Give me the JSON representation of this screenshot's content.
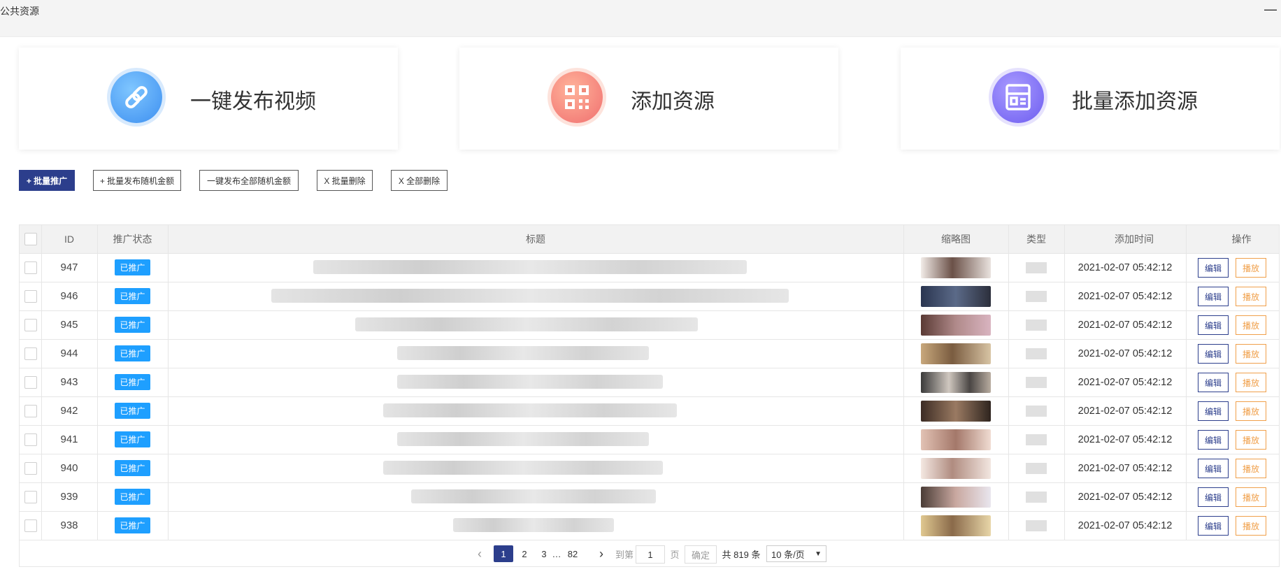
{
  "window": {
    "title": "公共资源",
    "minimize_label": "—"
  },
  "cards": [
    {
      "label": "一键发布视频",
      "icon": "link-icon",
      "color": "#3d8ff0"
    },
    {
      "label": "添加资源",
      "icon": "qrcode-icon",
      "color": "#f06f6f"
    },
    {
      "label": "批量添加资源",
      "icon": "list-icon",
      "color": "#7b6cf0"
    }
  ],
  "toolbar": {
    "batch_promote": "+ 批量推广",
    "batch_publish_random": "+ 批量发布随机金额",
    "publish_all_random": "一键发布全部随机金额",
    "batch_delete": "X 批量删除",
    "delete_all": "X 全部删除"
  },
  "table": {
    "headers": {
      "id": "ID",
      "status": "推广状态",
      "title": "标题",
      "thumbnail": "缩略图",
      "type": "类型",
      "added_time": "添加时间",
      "actions": "操作"
    },
    "edit_label": "编辑",
    "play_label": "播放",
    "rows": [
      {
        "id": "947",
        "status": "已推广",
        "added_time": "2021-02-07 05:42:12"
      },
      {
        "id": "946",
        "status": "已推广",
        "added_time": "2021-02-07 05:42:12"
      },
      {
        "id": "945",
        "status": "已推广",
        "added_time": "2021-02-07 05:42:12"
      },
      {
        "id": "944",
        "status": "已推广",
        "added_time": "2021-02-07 05:42:12"
      },
      {
        "id": "943",
        "status": "已推广",
        "added_time": "2021-02-07 05:42:12"
      },
      {
        "id": "942",
        "status": "已推广",
        "added_time": "2021-02-07 05:42:12"
      },
      {
        "id": "941",
        "status": "已推广",
        "added_time": "2021-02-07 05:42:12"
      },
      {
        "id": "940",
        "status": "已推广",
        "added_time": "2021-02-07 05:42:12"
      },
      {
        "id": "939",
        "status": "已推广",
        "added_time": "2021-02-07 05:42:12"
      },
      {
        "id": "938",
        "status": "已推广",
        "added_time": "2021-02-07 05:42:12"
      }
    ]
  },
  "pagination": {
    "prev_icon": "chevron-left-icon",
    "next_icon": "chevron-right-icon",
    "pages": [
      "1",
      "2",
      "3"
    ],
    "ellipsis": "…",
    "last_page": "82",
    "goto_label": "到第",
    "goto_value": "1",
    "page_unit": "页",
    "confirm_label": "确定",
    "total_text": "共 819 条",
    "page_size": "10 条/页"
  }
}
